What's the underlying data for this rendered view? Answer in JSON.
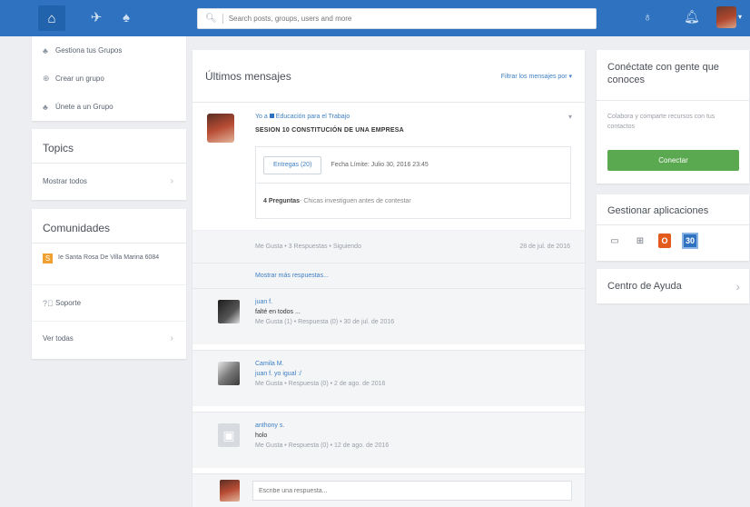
{
  "topbar": {
    "home_icon": "home-icon",
    "activity_icon": "activity-icon",
    "groups_icon": "groups-icon",
    "search_placeholder": "Search posts, groups, users and more",
    "backpack_icon": "backpack-icon",
    "bell_icon": "bell-icon"
  },
  "left_menu": {
    "items": [
      {
        "icon": "groups-icon",
        "label": "Gestiona tus Grupos"
      },
      {
        "icon": "plus-icon",
        "label": "Crear un grupo"
      },
      {
        "icon": "join-icon",
        "label": "Únete a un Grupo"
      }
    ]
  },
  "topics": {
    "title": "Topics",
    "show_all": "Mostrar todos"
  },
  "communities": {
    "title": "Comunidades",
    "items": [
      {
        "badge": "S",
        "label": "Ie Santa Rosa De Villa Marina 6084"
      }
    ],
    "support": "Soporte",
    "see_all": "Ver todas"
  },
  "feed": {
    "title": "Últimos mensajes",
    "filter": "Filtrar los mensajes por",
    "post": {
      "meta_prefix": "Yo a",
      "meta_group": "Educación para el Trabajo",
      "title": "SESION 10 CONSTITUCIÓN DE UNA EMPRESA",
      "deliveries_button": "Entregas (20)",
      "due_date": "Fecha Límite: Julio 30, 2016 23:45",
      "questions_bold": "4 Preguntas",
      "questions_text": " - Chicas investiguen antes de contestar",
      "actions": "Me Gusta  •  3 Respuestas  •  Siguiendo",
      "date": "28 de jul. de 2016",
      "more_replies": "Mostrar más respuestas..."
    },
    "replies": [
      {
        "name": "juan f.",
        "text": "falté en todos ...",
        "meta": "Me Gusta (1)  •  Respuesta (0)  •  30 de jul. de 2016"
      },
      {
        "name": "Camila M.",
        "text": "juan f. yo igual :/",
        "meta": "Me Gusta  •  Respuesta (0)  •  2 de ago. de 2016"
      },
      {
        "name": "anthony s.",
        "text": "holo",
        "meta": "Me Gusta  •  Respuesta (0)  •  12 de ago. de 2016"
      }
    ],
    "reply_placeholder": "Escribe una respuesta..."
  },
  "connect": {
    "title": "Conéctate con gente que conoces",
    "desc": "Colabora y comparte recursos con tus contactos",
    "button": "Conectar"
  },
  "apps": {
    "title": "Gestionar aplicaciones",
    "calendar_day": "30"
  },
  "help": {
    "title": "Centro de Ayuda"
  }
}
